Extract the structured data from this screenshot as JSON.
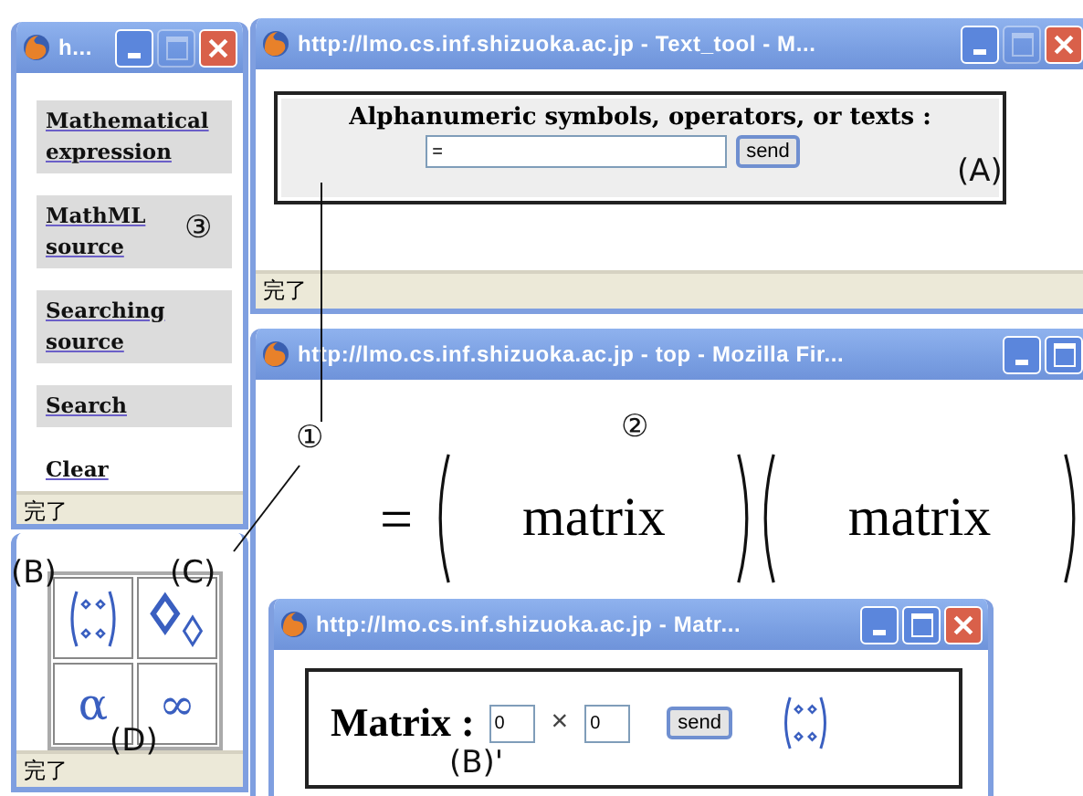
{
  "menu_window": {
    "title": "h...",
    "controls": [
      {
        "kind": "minimize",
        "disabled": false
      },
      {
        "kind": "maximize",
        "disabled": true
      },
      {
        "kind": "close",
        "disabled": false
      }
    ],
    "links": [
      {
        "label": "Mathematical expression",
        "boxed": true
      },
      {
        "label": "MathML source",
        "boxed": true
      },
      {
        "label": "Searching source",
        "boxed": true
      },
      {
        "label": "Search",
        "boxed": true
      },
      {
        "label": "Clear",
        "boxed": false
      }
    ],
    "status": "完了"
  },
  "palette_window": {
    "cells": [
      {
        "kind": "matrix"
      },
      {
        "kind": "diamonds"
      },
      {
        "kind": "symbol",
        "symbol": "α"
      },
      {
        "kind": "symbol",
        "symbol": "∞"
      }
    ],
    "status": "完了"
  },
  "text_tool_window": {
    "title": "http://lmo.cs.inf.shizuoka.ac.jp - Text_tool - M...",
    "controls": [
      {
        "kind": "minimize",
        "disabled": false
      },
      {
        "kind": "maximize",
        "disabled": true
      },
      {
        "kind": "close",
        "disabled": false
      }
    ],
    "prompt": "Alphanumeric symbols, operators, or texts :",
    "input": "=",
    "button": "send",
    "status": "完了"
  },
  "top_window": {
    "title": "http://lmo.cs.inf.shizuoka.ac.jp - top - Mozilla Fir...",
    "controls": [
      {
        "kind": "minimize",
        "disabled": false
      },
      {
        "kind": "maximize",
        "disabled": false
      }
    ],
    "formula": {
      "lead": "=",
      "terms": [
        "matrix",
        "matrix"
      ]
    }
  },
  "matrix_window": {
    "title": "http://lmo.cs.inf.shizuoka.ac.jp - Matr...",
    "controls": [
      {
        "kind": "minimize",
        "disabled": false
      },
      {
        "kind": "maximize",
        "disabled": false
      },
      {
        "kind": "close",
        "disabled": false
      }
    ],
    "label": "Matrix :",
    "rows": "0",
    "times": "×",
    "cols": "0",
    "button": "send"
  },
  "annotations": [
    {
      "text": "①"
    },
    {
      "text": "②"
    },
    {
      "text": "③"
    },
    {
      "text": "(A)"
    },
    {
      "text": "(B)"
    },
    {
      "text": "(C)"
    },
    {
      "text": "(D)"
    },
    {
      "text": "(B)'"
    }
  ]
}
